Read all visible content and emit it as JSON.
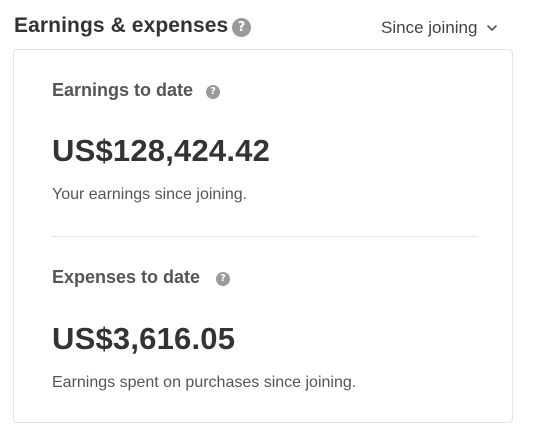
{
  "header": {
    "title": "Earnings & expenses",
    "help_icon": "question-circle-icon",
    "period": {
      "selected": "Since joining",
      "icon": "chevron-down-icon"
    }
  },
  "earnings": {
    "title": "Earnings to date",
    "help_icon": "question-circle-icon",
    "amount": "US$128,424.42",
    "description": "Your earnings since joining."
  },
  "expenses": {
    "title": "Expenses to date",
    "help_icon": "question-circle-icon",
    "amount": "US$3,616.05",
    "description": "Earnings spent on purchases since joining."
  },
  "colors": {
    "text_primary": "#333333",
    "text_secondary": "#555555",
    "icon_gray": "#9a9a9a",
    "border": "#e3e3e3"
  }
}
